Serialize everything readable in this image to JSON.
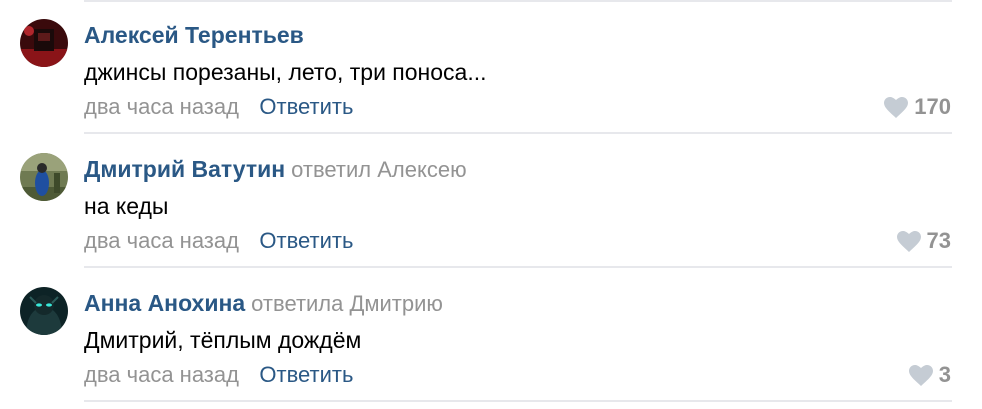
{
  "comments": [
    {
      "author": "Алексей Терентьев",
      "reply_to": "",
      "text": "джинсы порезаны, лето, три поноса...",
      "time": "два часа назад",
      "reply_label": "Ответить",
      "likes": "170",
      "avatar_icon": "user-avatar-dark-red"
    },
    {
      "author": "Дмитрий Ватутин",
      "reply_to": "ответил Алексею",
      "text": "на кеды",
      "time": "два часа назад",
      "reply_label": "Ответить",
      "likes": "73",
      "avatar_icon": "user-avatar-outdoor"
    },
    {
      "author": "Анна Анохина",
      "reply_to": "ответила Дмитрию",
      "text": "Дмитрий, тёплым дождём",
      "time": "два часа назад",
      "reply_label": "Ответить",
      "likes": "3",
      "avatar_icon": "user-avatar-cartoon"
    }
  ],
  "colors": {
    "author_link": "#2a5885",
    "secondary_text": "#939393",
    "body_text": "#000000",
    "divider": "#e7e8ec",
    "heart": "#c5ccd4"
  }
}
